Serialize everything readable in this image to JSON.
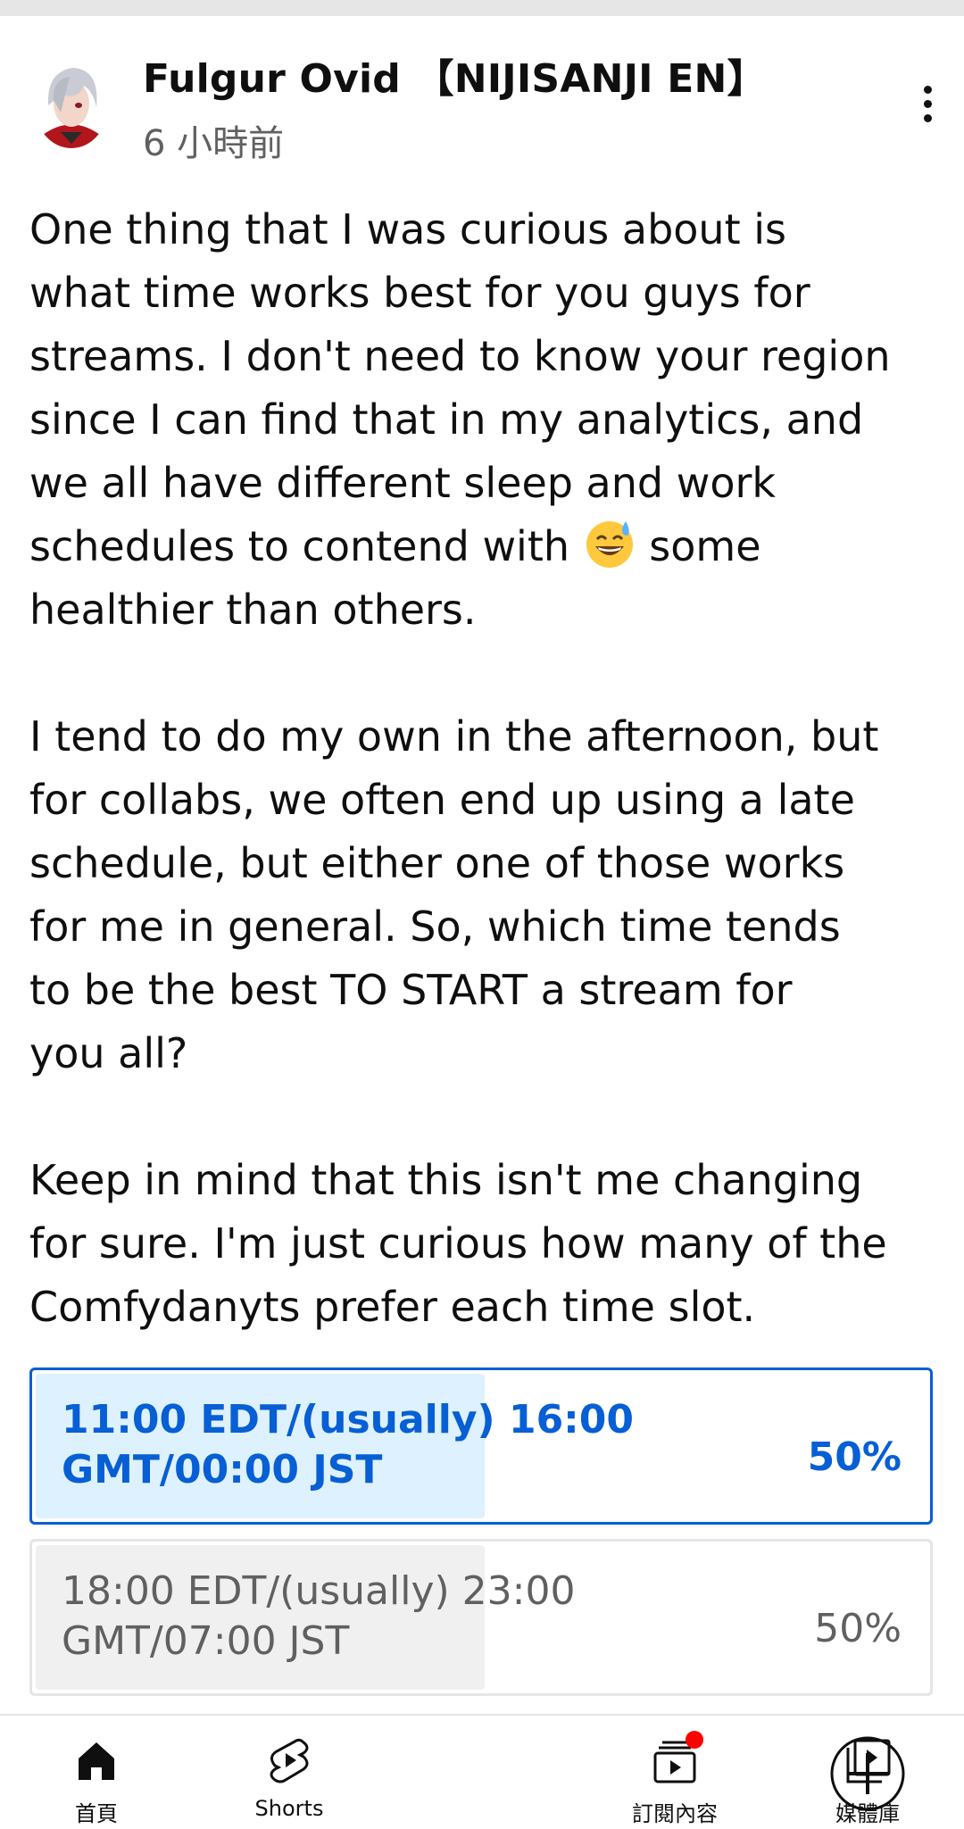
{
  "post": {
    "channel_name": "Fulgur Ovid 【NIJISANJI EN】",
    "time_ago": "6 小時前",
    "text_p1_a": "One thing that I was curious about is\nwhat time works best for you guys for\nstreams. I don't need to know your region\nsince I can find that in my analytics, and\nwe all have different sleep and work\nschedules to contend with ",
    "emoji": "sweat-smile-emoji",
    "text_p1_b": " some\nhealthier than others.\n\nI tend to do my own in the afternoon, but\nfor collabs, we often end up using a late\nschedule, but either one of those works\nfor me in general. So, which time tends\nto be the best TO START a stream for\nyou all?\n\nKeep in mind that this isn't me changing\nfor sure. I'm just curious how many of the\nComfydanyts prefer each time slot."
  },
  "poll": {
    "options": [
      {
        "label": "11:00 EDT/(usually) 16:00 GMT/00:00 JST",
        "percent": "50%",
        "fraction": 0.5,
        "selected": true
      },
      {
        "label": "18:00 EDT/(usually) 23:00 GMT/07:00 JST",
        "percent": "50%",
        "fraction": 0.5,
        "selected": false
      }
    ]
  },
  "bottom_nav": {
    "home": "首頁",
    "shorts": "Shorts",
    "subscriptions": "訂閱內容",
    "library": "媒體庫"
  },
  "colors": {
    "accent": "#065fd4",
    "selected_fill": "#def1ff",
    "unselected_fill": "#f0f0f0",
    "badge": "#ff0000"
  }
}
